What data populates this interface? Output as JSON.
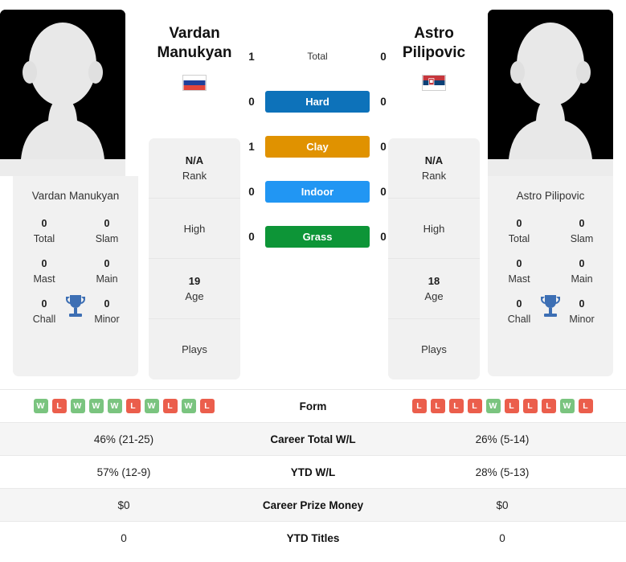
{
  "players": {
    "left": {
      "first_name": "Vardan",
      "last_name": "Manukyan",
      "full_name": "Vardan Manukyan",
      "flag_country": "Russia",
      "flag_icon": "flag-russia-icon",
      "avatar_icon": "player-silhouette-icon",
      "rank": "N/A",
      "rank_label": "Rank",
      "high_value": "",
      "high_label": "High",
      "age": "19",
      "age_label": "Age",
      "plays_value": "",
      "plays_label": "Plays",
      "titles": {
        "total": "0",
        "total_label": "Total",
        "slam": "0",
        "slam_label": "Slam",
        "mast": "0",
        "mast_label": "Mast",
        "main": "0",
        "main_label": "Main",
        "chall": "0",
        "chall_label": "Chall",
        "minor": "0",
        "minor_label": "Minor"
      },
      "form": [
        "W",
        "L",
        "W",
        "W",
        "W",
        "L",
        "W",
        "L",
        "W",
        "L"
      ],
      "career_total_wl": "46% (21-25)",
      "ytd_wl": "57% (12-9)",
      "career_prize_money": "$0",
      "ytd_titles": "0"
    },
    "right": {
      "first_name": "Astro",
      "last_name": "Pilipovic",
      "full_name": "Astro Pilipovic",
      "flag_country": "Serbia",
      "flag_icon": "flag-serbia-icon",
      "avatar_icon": "player-silhouette-icon",
      "rank": "N/A",
      "rank_label": "Rank",
      "high_value": "",
      "high_label": "High",
      "age": "18",
      "age_label": "Age",
      "plays_value": "",
      "plays_label": "Plays",
      "titles": {
        "total": "0",
        "total_label": "Total",
        "slam": "0",
        "slam_label": "Slam",
        "mast": "0",
        "mast_label": "Mast",
        "main": "0",
        "main_label": "Main",
        "chall": "0",
        "chall_label": "Chall",
        "minor": "0",
        "minor_label": "Minor"
      },
      "form": [
        "L",
        "L",
        "L",
        "L",
        "W",
        "L",
        "L",
        "L",
        "W",
        "L"
      ],
      "career_total_wl": "26% (5-14)",
      "ytd_wl": "28% (5-13)",
      "career_prize_money": "$0",
      "ytd_titles": "0"
    }
  },
  "head_to_head": {
    "total": {
      "label": "Total",
      "left": "1",
      "right": "0"
    },
    "surfaces": [
      {
        "label": "Hard",
        "left": "0",
        "right": "0",
        "color": "#0d72ba"
      },
      {
        "label": "Clay",
        "left": "1",
        "right": "0",
        "color": "#e09200"
      },
      {
        "label": "Indoor",
        "left": "0",
        "right": "0",
        "color": "#2196f3"
      },
      {
        "label": "Grass",
        "left": "0",
        "right": "0",
        "color": "#0d9537"
      }
    ]
  },
  "stats_table": {
    "rows": [
      {
        "label": "Form"
      },
      {
        "label": "Career Total W/L"
      },
      {
        "label": "YTD W/L"
      },
      {
        "label": "Career Prize Money"
      },
      {
        "label": "YTD Titles"
      }
    ]
  },
  "colors": {
    "win_badge": "#7ac47f",
    "loss_badge": "#eb5e4c",
    "panel_bg": "#f1f1f1",
    "row_alt_bg": "#f5f5f5",
    "trophy": "#3d6fb4"
  }
}
